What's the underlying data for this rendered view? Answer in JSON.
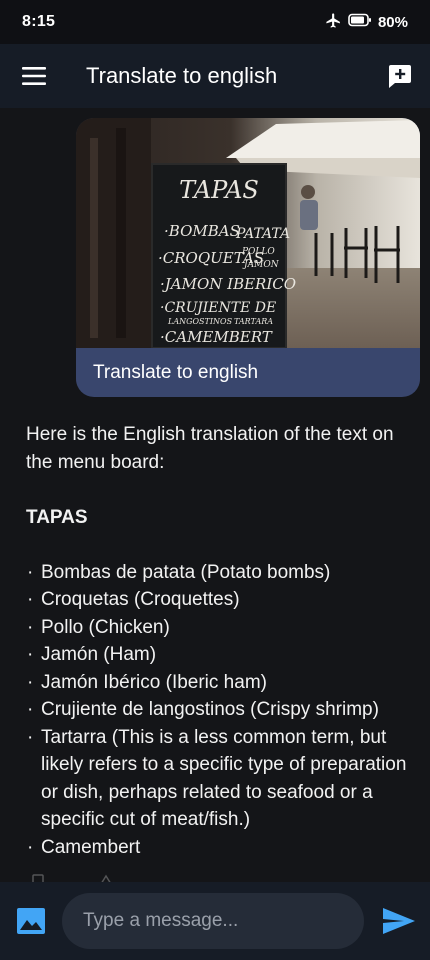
{
  "status_bar": {
    "time": "8:15",
    "battery": "80%",
    "icons": [
      "airplane-mode-icon",
      "battery-icon"
    ]
  },
  "app_bar": {
    "title": "Translate to english",
    "icons": [
      "menu-icon",
      "new-chat-icon"
    ]
  },
  "user_message": {
    "image_text": {
      "heading": "TAPAS",
      "lines": [
        "·BOMBAS",
        "PATATA",
        "·CROQUETAS",
        "POLLO",
        "JAMON",
        "·JAMON IBERICO",
        "·CRUJIENTE DE",
        "LANGOSTINOS",
        "TARTARA",
        "·CAMEMBERT"
      ]
    },
    "text": "Translate to english"
  },
  "assistant_message": {
    "intro": "Here is the English translation of the text on the menu board:",
    "heading": "TAPAS",
    "items": [
      "Bombas de patata (Potato bombs)",
      "Croquetas (Croquettes)",
      "Pollo (Chicken)",
      "Jamón (Ham)",
      "Jamón Ibérico (Iberic ham)",
      "Crujiente de langostinos (Crispy shrimp)",
      "Tartarra (This is a less common term, but likely refers to a specific type of preparation or dish, perhaps related to seafood or a specific cut of meat/fish.)",
      "Camembert"
    ]
  },
  "composer": {
    "placeholder": "Type a message...",
    "icons": [
      "image-icon",
      "send-icon"
    ]
  },
  "colors": {
    "accent": "#42a5f5",
    "bubble": "#39466d",
    "bar": "#161c26",
    "background": "#141518"
  }
}
